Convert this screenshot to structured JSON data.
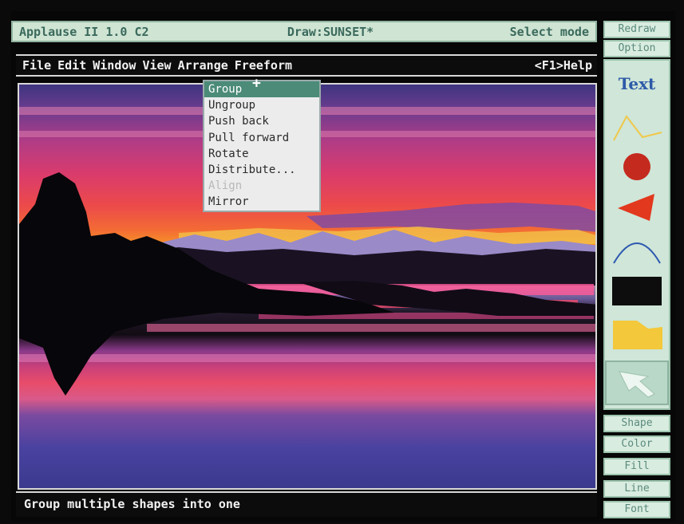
{
  "titlebar": {
    "app": "Applause II  1.0  C2",
    "document": "Draw:SUNSET*",
    "mode": "Select mode"
  },
  "menubar": {
    "menus": [
      "File",
      "Edit",
      "Window",
      "View",
      "Arrange",
      "Freeform"
    ],
    "help": "<F1>Help"
  },
  "arrange_menu": {
    "items": [
      "Group",
      "Ungroup",
      "Push back",
      "Pull forward",
      "Rotate",
      "Distribute...",
      "Align",
      "Mirror"
    ],
    "selected": "Group",
    "disabled": [
      "Align"
    ]
  },
  "panel": {
    "top_buttons": [
      "Redraw",
      "Option"
    ],
    "tools": [
      "text-tool",
      "freeform-line-tool",
      "circle-tool",
      "triangle-tool",
      "arc-tool",
      "rectangle-tool",
      "polygon-tool",
      "arrow-select-tool"
    ],
    "text_tool_label": "Text",
    "bottom_buttons": [
      "Shape",
      "Color",
      "Fill",
      "Line",
      "Font"
    ]
  },
  "status": "Group multiple shapes into one"
}
